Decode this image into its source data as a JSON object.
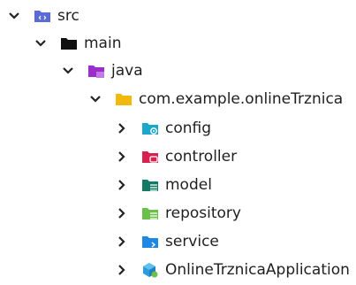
{
  "tree": {
    "src": {
      "label": "src",
      "expanded": true,
      "icon": "source-folder-icon"
    },
    "main": {
      "label": "main",
      "expanded": true,
      "icon": "black-folder-icon"
    },
    "java": {
      "label": "java",
      "expanded": true,
      "icon": "java-source-folder-icon"
    },
    "package": {
      "label": "com.example.onlineTrznica",
      "expanded": true,
      "icon": "package-folder-icon"
    },
    "children": [
      {
        "label": "config",
        "expanded": false,
        "icon": "config-folder-icon",
        "color": "#1aa7c9"
      },
      {
        "label": "controller",
        "expanded": false,
        "icon": "controller-folder-icon",
        "color": "#d8214f"
      },
      {
        "label": "model",
        "expanded": false,
        "icon": "model-folder-icon",
        "color": "#137a63"
      },
      {
        "label": "repository",
        "expanded": false,
        "icon": "repository-folder-icon",
        "color": "#6cc04a"
      },
      {
        "label": "service",
        "expanded": false,
        "icon": "service-folder-icon",
        "color": "#1f88e5"
      },
      {
        "label": "OnlineTrznicaApplication",
        "expanded": false,
        "icon": "java-class-icon",
        "color": "#2d9cdb"
      }
    ]
  },
  "colors": {
    "chevron": "#222222",
    "src_folder": "#5a6bd8",
    "main_folder": "#111111",
    "java_folder": "#9b2fc9",
    "package_folder": "#f0b90b"
  }
}
